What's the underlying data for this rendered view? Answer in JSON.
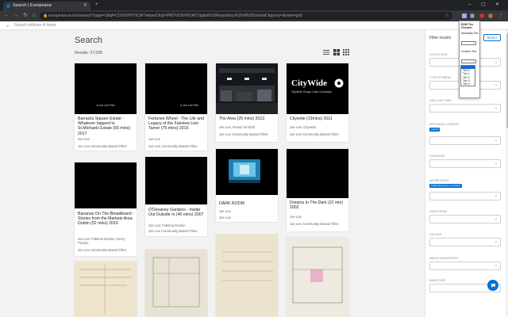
{
  "browser": {
    "tab_title": "Search | Europeana",
    "url": "europeana.eu/en/search?page=1&qf=COUNTRY%3A\"Ireland\"&qf=PROVIDER%3A\"Digital%20Repository%20of%20Ireland\"&query=&view=grid"
  },
  "site": {
    "search_placeholder": "Search millions of items"
  },
  "main": {
    "title": "Search",
    "results": "Results: 27,008"
  },
  "cards": [
    {
      "title": "Barracks Square Estate - Whatever happed to St.Michaels Estate (65 mins) 2017",
      "meta": "Joe Lee",
      "provider": "Joe Lee Community Based Films",
      "thumb_caption": "A Joe Lee Film"
    },
    {
      "title": "Fortunes Wheel - The Life and Legacy of the Fairview Lion Tamer (76 mins) 2015",
      "meta": "Joe Lee",
      "provider": "Joe Lee Community Based Films",
      "thumb_caption": "A Joe Lee Film"
    },
    {
      "title": "The Area (25 mins) 2013",
      "meta": "Joe Lee; Ronan Ni Nicill",
      "provider": "Joe Lee Community Based Films",
      "thumb_caption": ""
    },
    {
      "title": "Citywide (13mins) 2011",
      "meta": "Joe Lee; Citywide",
      "provider": "Joe Lee Community Based Films",
      "thumb_caption": "CityWide Drugs Crisis Campaign"
    },
    {
      "title": "Bananas On The Breadboard - Stories from the Markets Area Dublin (52 mins) 2010",
      "meta": "Joe Lee; Fidelma Donlon; Gerry Purdon",
      "provider": "Joe Lee Community Based Films",
      "thumb_caption": ""
    },
    {
      "title": "O'Devaney Gardens - Inside Out Outside In (40 mins) 2007",
      "meta": "Joe Lee; Fidelma Donlon",
      "provider": "Joe Lee Community Based Films",
      "thumb_caption": ""
    },
    {
      "title": "DARK ROOM",
      "meta": "Joe Lee",
      "provider": "Joe Lee",
      "thumb_caption": ""
    },
    {
      "title": "Dreams In The Dark (22 min) 2002",
      "meta": "Joe Lee",
      "provider": "Joe Lee Community Based Films",
      "thumb_caption": ""
    }
  ],
  "filters": {
    "title": "Filter results",
    "reset_label": "RESET",
    "sections": [
      {
        "label": "COLLECTION"
      },
      {
        "label": "TYPE OF MEDIA"
      },
      {
        "label": "CAN I USE THIS?"
      },
      {
        "label": "PROVIDING COUNTRY",
        "chip": "Ireland"
      },
      {
        "label": "LANGUAGE"
      },
      {
        "label": "AGGREGATOR",
        "chip": "Digital Repository of Ireland"
      },
      {
        "label": "INSTITUTION"
      },
      {
        "label": "COLOUR"
      },
      {
        "label": "IMAGE ORIENTATION"
      },
      {
        "label": "IMAGE SIZE"
      }
    ]
  },
  "popup": {
    "title": "EDM Tier Checker",
    "metadata_label": "Metadata Tier:",
    "content_label": "Content Tier:",
    "options": [
      "",
      "Tier 0",
      "Tier 1",
      "Tier 2",
      "Tier 3",
      "Tier 4"
    ]
  },
  "colors": {
    "accent": "#0a72cc",
    "chrome_dark": "#202124",
    "chrome_mid": "#35363a"
  }
}
